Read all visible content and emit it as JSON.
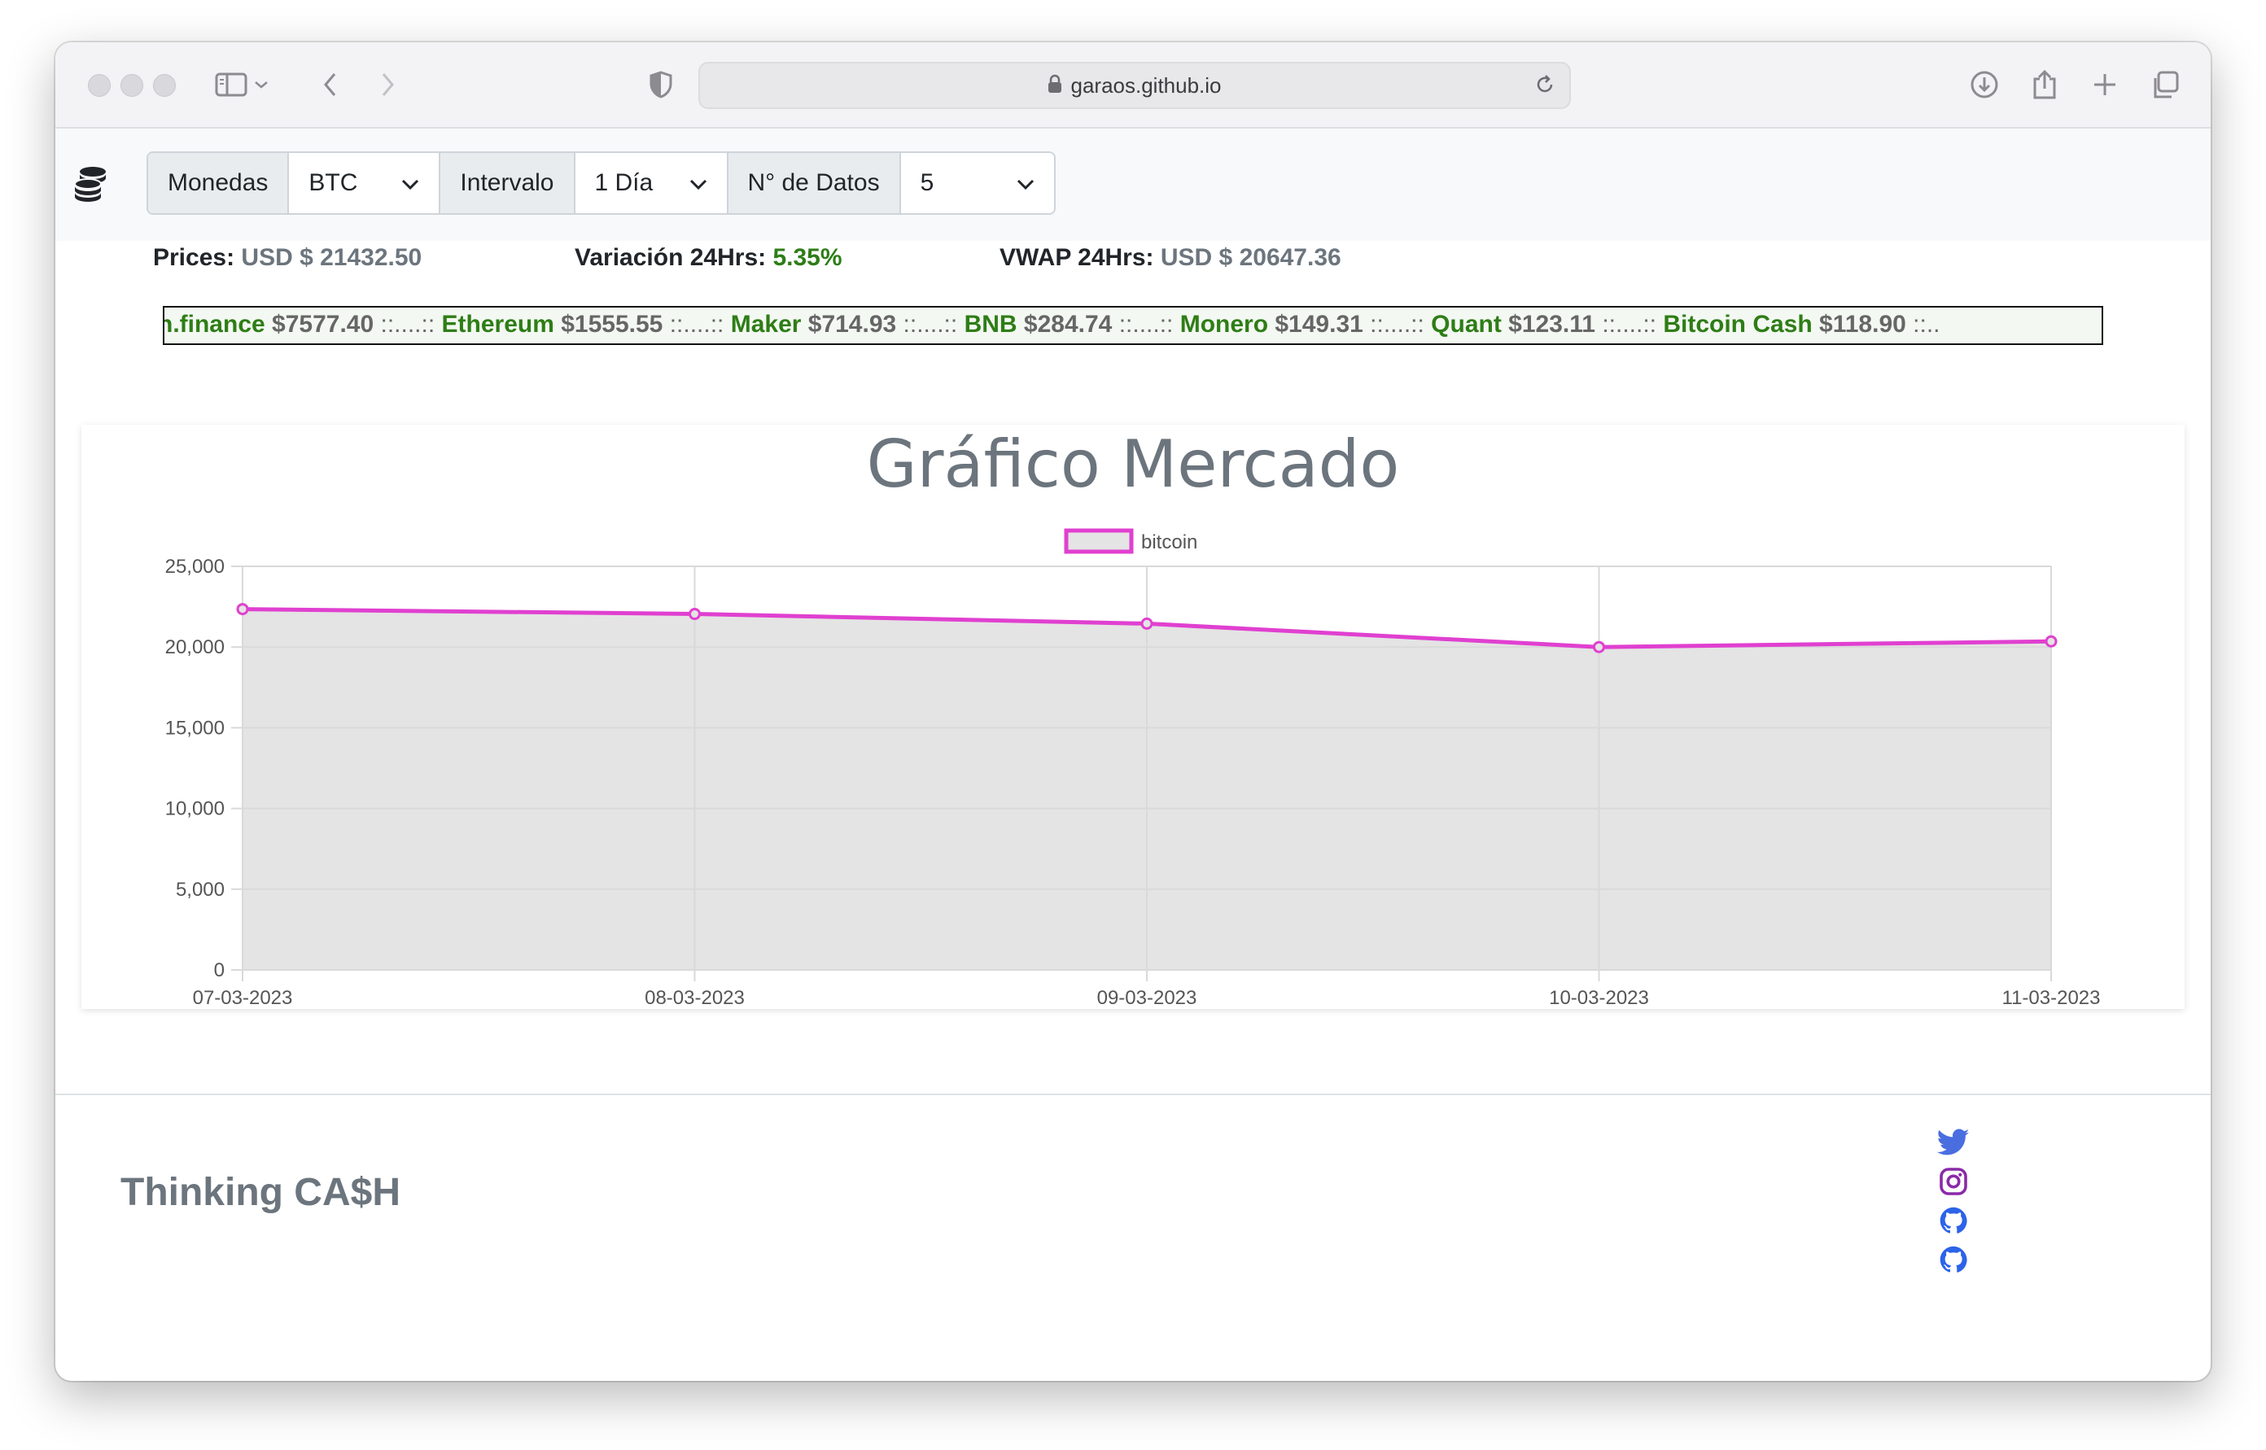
{
  "browser": {
    "url": "garaos.github.io"
  },
  "nav": {
    "coins_label": "Monedas",
    "coins_value": "BTC",
    "interval_label": "Intervalo",
    "interval_value": "1 Día",
    "datapoints_label": "N° de Datos",
    "datapoints_value": "5"
  },
  "stats": {
    "price_label": "Prices:",
    "price_value": "USD $ 21432.50",
    "variation_label": "Variación 24Hrs:",
    "variation_value": "5.35%",
    "vwap_label": "VWAP 24Hrs:",
    "vwap_value": "USD $ 20647.36"
  },
  "ticker": [
    {
      "name": "n.finance",
      "price": "$7577.40"
    },
    {
      "name": "Ethereum",
      "price": "$1555.55"
    },
    {
      "name": "Maker",
      "price": "$714.93"
    },
    {
      "name": "BNB",
      "price": "$284.74"
    },
    {
      "name": "Monero",
      "price": "$149.31"
    },
    {
      "name": "Quant",
      "price": "$123.11"
    },
    {
      "name": "Bitcoin Cash",
      "price": "$118.90"
    }
  ],
  "ticker_separator": "::....::",
  "ticker_tail": "::..",
  "chart_data": {
    "type": "area",
    "title": "Gráfico Mercado",
    "categories": [
      "07-03-2023",
      "08-03-2023",
      "09-03-2023",
      "10-03-2023",
      "11-03-2023"
    ],
    "series": [
      {
        "name": "bitcoin",
        "values": [
          22350,
          22050,
          21450,
          20000,
          20350
        ]
      }
    ],
    "ylim": [
      0,
      25000
    ],
    "yticks": [
      "0",
      "5,000",
      "10,000",
      "15,000",
      "20,000",
      "25,000"
    ],
    "grid": true,
    "legend": "top",
    "colors": {
      "line": "#e040d0",
      "fill": "#e4e4e4",
      "grid": "#d9d9d9"
    }
  },
  "footer": {
    "brand": "Thinking CA$H",
    "social": [
      "twitter-icon",
      "instagram-icon",
      "github-icon",
      "github-icon"
    ]
  }
}
